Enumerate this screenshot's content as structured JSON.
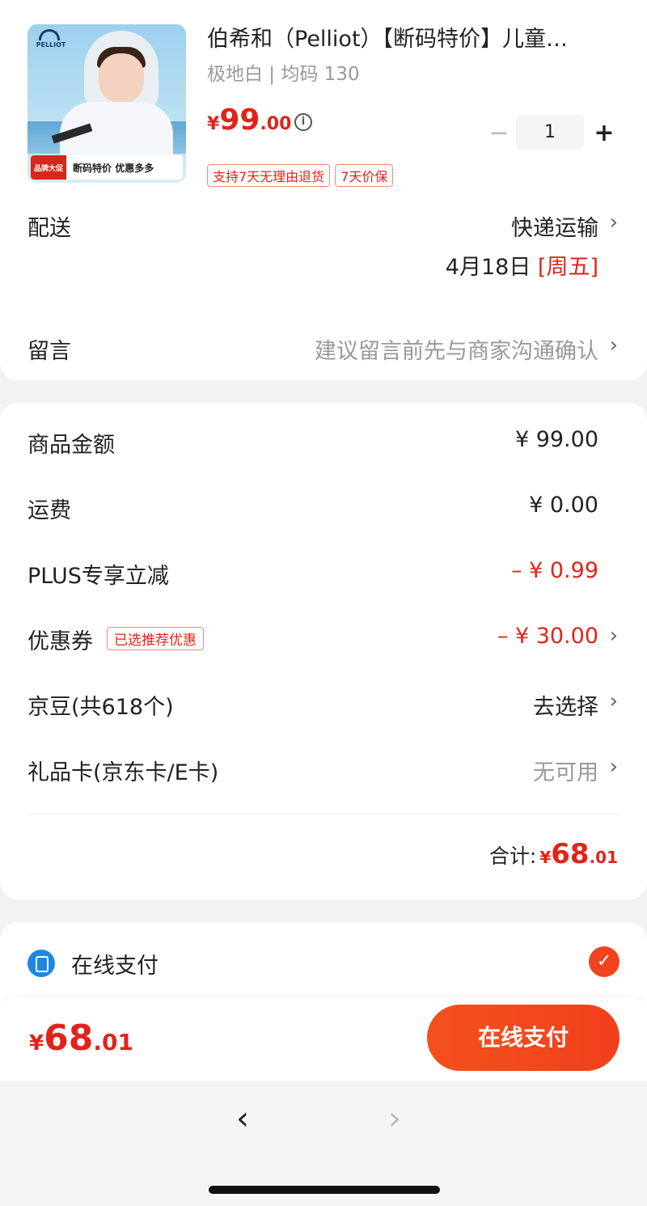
{
  "product": {
    "title": "伯希和（Pelliot）【断码特价】儿童…",
    "spec": "极地白 | 均码 130",
    "price_currency": "¥",
    "price_int": "99",
    "price_dec": ".00",
    "quantity": "1",
    "thumb_brand": "PELLIOT",
    "thumb_badge": "品牌大促",
    "thumb_banner": "断码特价  优惠多多",
    "tags": [
      "支持7天无理由退货",
      "7天价保"
    ]
  },
  "delivery": {
    "label": "配送",
    "method": "快递运输",
    "date": "4月18日",
    "weekday": "[周五]"
  },
  "message": {
    "label": "留言",
    "placeholder": "建议留言前先与商家沟通确认"
  },
  "summary": {
    "goods_label": "商品金额",
    "goods_value": "¥ 99.00",
    "shipping_label": "运费",
    "shipping_value": "¥ 0.00",
    "plus_label": "PLUS专享立减",
    "plus_value": "– ¥ 0.99",
    "coupon_label": "优惠券",
    "coupon_tag": "已选推荐优惠",
    "coupon_value": "– ¥ 30.00",
    "jingdou_label": "京豆(共618个)",
    "jingdou_value": "去选择",
    "giftcard_label": "礼品卡(京东卡/E卡)",
    "giftcard_value": "无可用",
    "total_label": "合计:",
    "total_currency": "¥",
    "total_int": "68",
    "total_dec": ".01"
  },
  "payment": {
    "method_label": "在线支付",
    "selected": true
  },
  "footer": {
    "price_currency": "¥",
    "price_int": "68",
    "price_dec": ".01",
    "button_label": "在线支付"
  },
  "colors": {
    "accent": "#e2231a",
    "button": "#f4511e",
    "pay_icon": "#1f87e0"
  },
  "icons": {
    "chevron": "chevron-right-icon",
    "info": "info-icon",
    "check": "check-circle-icon",
    "back": "back-arrow-icon",
    "forward": "forward-arrow-icon"
  }
}
